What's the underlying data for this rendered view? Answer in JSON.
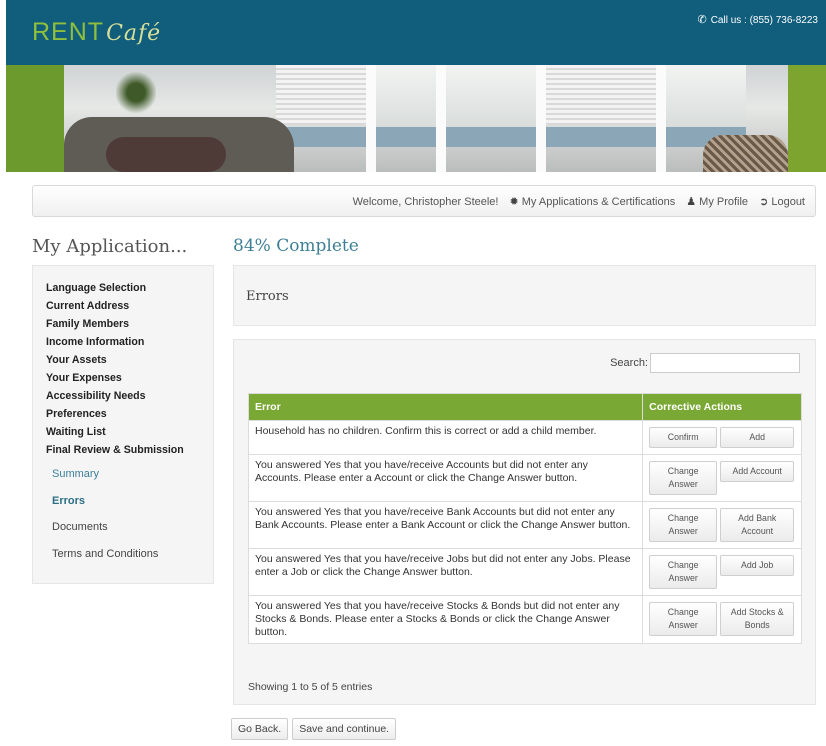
{
  "header": {
    "logo_main": "RENT",
    "logo_script": "Café",
    "phone": "Call us : (855) 736-8223",
    "phone_icon": "phone-icon"
  },
  "navbar": {
    "welcome": "Welcome, Christopher Steele!",
    "applications": "My Applications & Certifications",
    "profile": "My Profile",
    "logout": "Logout",
    "icons": [
      "gear-icon",
      "user-icon",
      "logout-icon"
    ]
  },
  "page": {
    "title": "My Application...",
    "progress": "84% Complete",
    "progress_value": 84
  },
  "sidebar": {
    "sections": [
      "Language Selection",
      "Current Address",
      "Family Members",
      "Income Information",
      "Your Assets",
      "Your Expenses",
      "Accessibility Needs",
      "Preferences",
      "Waiting List",
      "Final Review & Submission"
    ],
    "subitems": [
      "Summary",
      "Errors",
      "Documents",
      "Terms and Conditions"
    ],
    "active_subitem": "Errors"
  },
  "errors_panel": {
    "title": "Errors"
  },
  "table": {
    "search_label": "Search:",
    "search_value": "",
    "columns": [
      "Error",
      "Corrective Actions"
    ],
    "rows": [
      {
        "error": "Household has no children. Confirm this is correct or add a child member.",
        "action1": "Confirm",
        "action2": "Add"
      },
      {
        "error": "You answered Yes that you have/receive Accounts but did not enter any Accounts. Please enter a Account or click the Change Answer button.",
        "action1": "Change Answer",
        "action2": "Add Account"
      },
      {
        "error": "You answered Yes that you have/receive Bank Accounts but did not enter any Bank Accounts. Please enter a Bank Account or click the Change Answer button.",
        "action1": "Change Answer",
        "action2": "Add Bank Account"
      },
      {
        "error": "You answered Yes that you have/receive Jobs but did not enter any Jobs. Please enter a Job or click the Change Answer button.",
        "action1": "Change Answer",
        "action2": "Add Job"
      },
      {
        "error": "You answered Yes that you have/receive Stocks & Bonds but did not enter any Stocks & Bonds. Please enter a Stocks & Bonds or click the Change Answer button.",
        "action1": "Change Answer",
        "action2": "Add Stocks & Bonds"
      }
    ],
    "showing": "Showing 1 to 5 of 5 entries"
  },
  "footer": {
    "back": "Go Back.",
    "save": "Save and continue."
  },
  "colors": {
    "header": "#105d7c",
    "table_header": "#7aa834",
    "accent": "#3d7f96",
    "brand_green": "#8fbf3c"
  }
}
